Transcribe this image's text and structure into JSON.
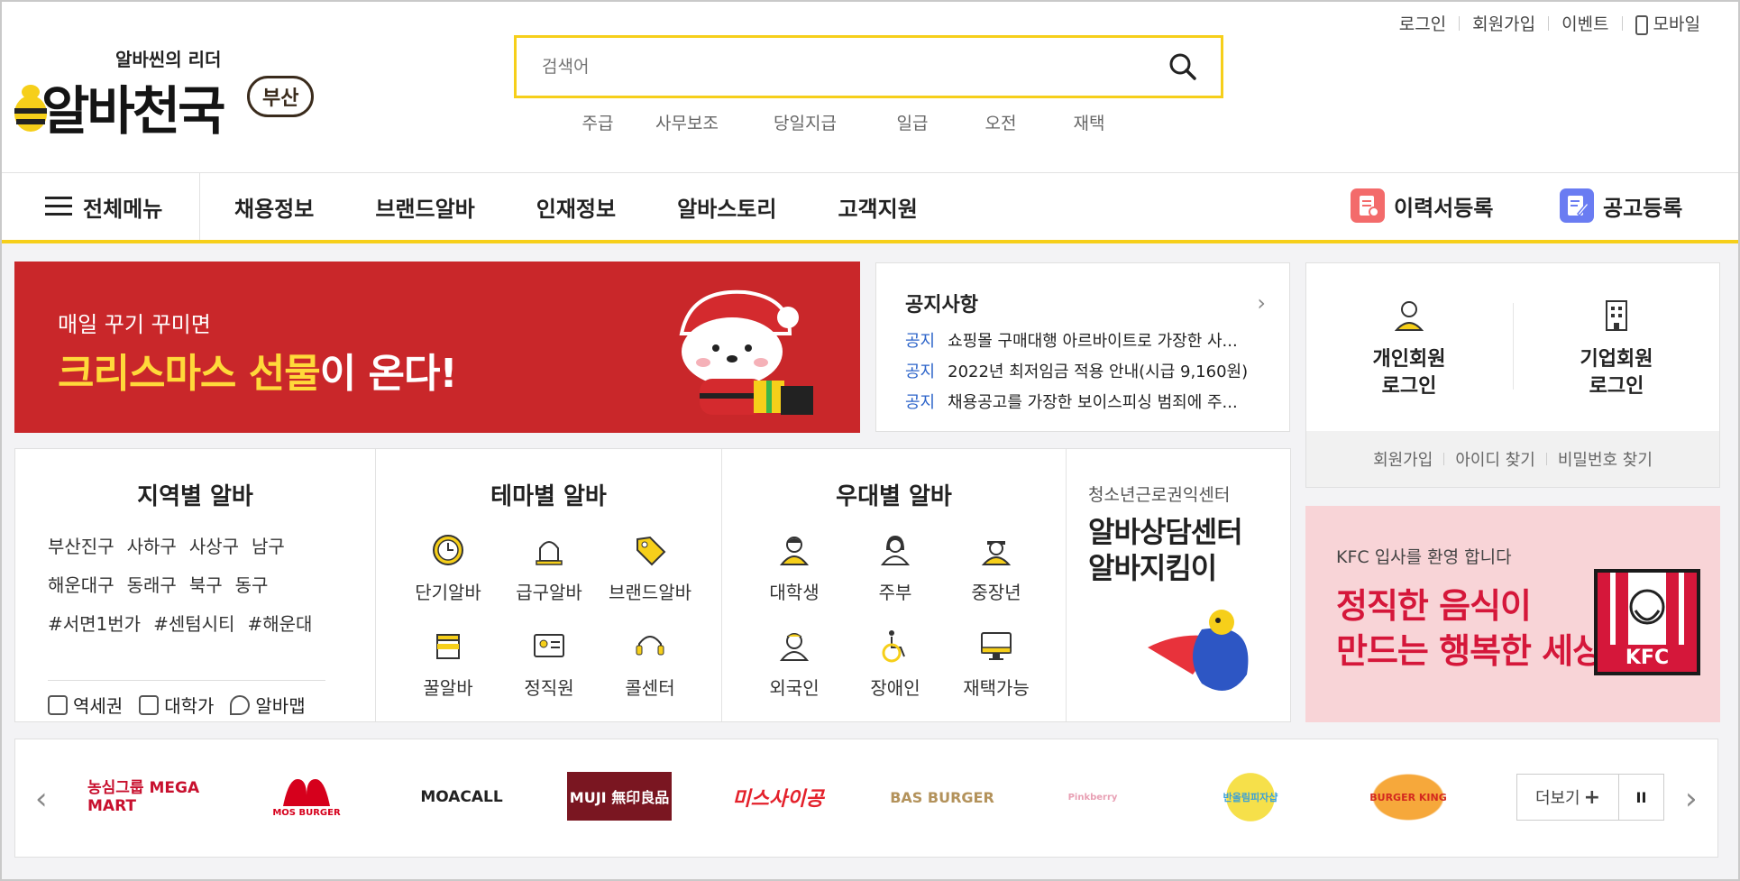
{
  "util_nav": {
    "login": "로그인",
    "signup": "회원가입",
    "event": "이벤트",
    "mobile": "모바일"
  },
  "logo": {
    "tagline": "알바씬의 리더",
    "name": "알바천국",
    "region": "부산"
  },
  "search": {
    "placeholder": "검색어",
    "keywords": [
      "주급",
      "사무보조",
      "당일지급",
      "일급",
      "오전",
      "재택"
    ]
  },
  "gnb": {
    "all_menu": "전체메뉴",
    "menu": [
      "채용정보",
      "브랜드알바",
      "인재정보",
      "알바스토리",
      "고객지원"
    ],
    "resume": "이력서등록",
    "post": "공고등록"
  },
  "banner": {
    "line1": "매일 꾸기 꾸미면",
    "line2_highlight": "크리스마스 선물",
    "line2_rest": "이 온다!"
  },
  "notice": {
    "title": "공지사항",
    "items": [
      {
        "cat": "공지",
        "text": "쇼핑몰 구매대행 아르바이트로 가장한 사..."
      },
      {
        "cat": "공지",
        "text": "2022년 최저임금 적용 안내(시급 9,160원)"
      },
      {
        "cat": "공지",
        "text": "채용공고를 가장한 보이스피싱 범죄에 주..."
      }
    ]
  },
  "login": {
    "personal": [
      "개인회원",
      "로그인"
    ],
    "company": [
      "기업회원",
      "로그인"
    ],
    "links": [
      "회원가입",
      "아이디 찾기",
      "비밀번호 찾기"
    ]
  },
  "regional": {
    "title": "지역별 알바",
    "rows": [
      [
        "부산진구",
        "사하구",
        "사상구",
        "남구"
      ],
      [
        "해운대구",
        "동래구",
        "북구",
        "동구"
      ],
      [
        "#서면1번가",
        "#센텀시티",
        "#해운대"
      ]
    ],
    "quick": [
      "역세권",
      "대학가",
      "알바맵"
    ]
  },
  "theme": {
    "title": "테마별 알바",
    "items": [
      "단기알바",
      "급구알바",
      "브랜드알바",
      "꿀알바",
      "정직원",
      "콜센터"
    ]
  },
  "preferred": {
    "title": "우대별 알바",
    "items": [
      "대학생",
      "주부",
      "중장년",
      "외국인",
      "장애인",
      "재택가능"
    ]
  },
  "counsel": {
    "org": "청소년근로권익센터",
    "line1": "알바상담센터",
    "line2": "알바지킴이"
  },
  "kfc": {
    "sub": "KFC 입사를 환영 합니다",
    "line1": "정직한 음식이",
    "line2": "만드는 행복한 세상",
    "logo_text": "KFC"
  },
  "brands": {
    "logos": [
      "농심그룹 MEGA MART",
      "MOS BURGER",
      "MOACALL",
      "MUJI 無印良品",
      "미스사이공",
      "BAS BURGER",
      "Pinkberry",
      "반올림피자샵",
      "BURGER KING"
    ],
    "more": "더보기",
    "pause": "II"
  },
  "colors": {
    "accent": "#f6cf1a",
    "notice_cat": "#2b63c9",
    "banner_bg": "#c9272a",
    "kfc_red": "#d5173a"
  }
}
